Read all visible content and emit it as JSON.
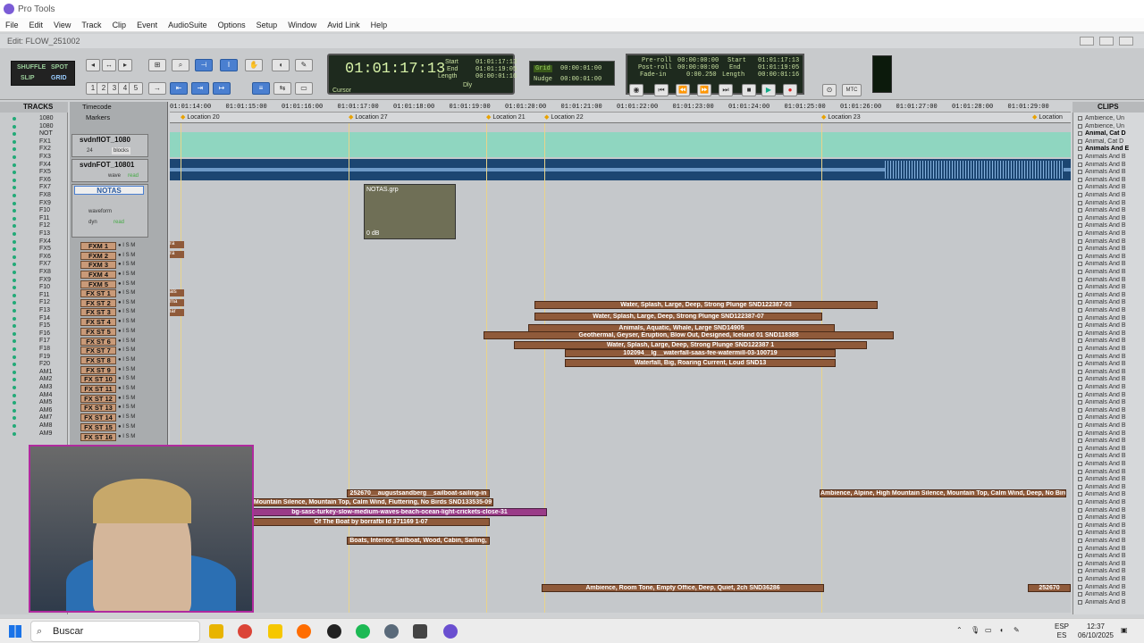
{
  "window": {
    "app_title": "Pro Tools",
    "edit_title": "Edit: FLOW_251002"
  },
  "menu": [
    "File",
    "Edit",
    "View",
    "Track",
    "Clip",
    "Event",
    "AudioSuite",
    "Options",
    "Setup",
    "Window",
    "Avid Link",
    "Help"
  ],
  "toolbar": {
    "modes": [
      "SHUFFLE",
      "SPOT",
      "SLIP",
      "GRID"
    ],
    "zoom_presets": [
      "1",
      "2",
      "3",
      "4",
      "5"
    ]
  },
  "counter": {
    "main": "01:01:17:13",
    "start_label": "Start",
    "end_label": "End",
    "length_label": "Length",
    "start": "01:01:17:13",
    "end": "01:01:19:05",
    "length": "00:00:01:16",
    "cursor_label": "Cursor",
    "dly": "Dly"
  },
  "grid": {
    "grid_label": "Grid",
    "grid_value": "00:00:01:00",
    "nudge_label": "Nudge",
    "nudge_value": "00:00:01:00"
  },
  "transport": {
    "preroll_label": "Pre-roll",
    "postroll_label": "Post-roll",
    "fadein_label": "Fade-in",
    "preroll": "00:00:00:00",
    "postroll": "00:00:00:00",
    "fadein": "0:00.250",
    "start_label": "Start",
    "end_label": "End",
    "length_label": "Length",
    "start": "01:01:17:13",
    "end": "01:01:19:05",
    "length": "00:00:01:16",
    "mtc": "MTC"
  },
  "tracks_panel": {
    "header": "TRACKS",
    "items": [
      "1080",
      "1080",
      "NOT",
      "FX1",
      "FX2",
      "FX3",
      "FX4",
      "FX5",
      "FX6",
      "FX7",
      "FX8",
      "FX9",
      "F10",
      "F11",
      "F12",
      "F13",
      "FX4",
      "FX5",
      "FX6",
      "FX7",
      "FX8",
      "FX9",
      "F10",
      "F11",
      "F12",
      "F13",
      "F14",
      "F15",
      "F16",
      "F17",
      "F18",
      "F19",
      "F20",
      "AM1",
      "AM2",
      "AM3",
      "AM4",
      "AM5",
      "AM6",
      "AM7",
      "AM8",
      "AM9"
    ]
  },
  "rulers": {
    "timecode_label": "Timecode",
    "markers_label": "Markers",
    "ticks": [
      "01:01:14:00",
      "01:01:15:00",
      "01:01:16:00",
      "01:01:17:00",
      "01:01:18:00",
      "01:01:19:00",
      "01:01:20:00",
      "01:01:21:00",
      "01:01:22:00",
      "01:01:23:00",
      "01:01:24:00",
      "01:01:25:00",
      "01:01:26:00",
      "01:01:27:00",
      "01:01:28:00",
      "01:01:29:00"
    ],
    "markers": [
      "Location 20",
      "Location 27",
      "Location 21",
      "Location 22",
      "Location 23",
      "Location"
    ]
  },
  "track_headers": {
    "video1": "svdnfIOT_1080",
    "video1_sub": "24",
    "video1_view": "blocks",
    "video2": "svdnFOT_10801",
    "video2_view": "wave",
    "video2_sub": "read",
    "notas": "NOTAS",
    "notas_view": "waveform",
    "notas_dyn": "dyn",
    "notas_read": "read",
    "fxm": [
      "FXM 1",
      "FXM 2",
      "FXM 3",
      "FXM 4",
      "FXM 5"
    ],
    "fxst": [
      "FX ST 1",
      "FX ST 2",
      "FX ST 3",
      "FX ST 4",
      "FX ST 5",
      "FX ST 6",
      "FX ST 7",
      "FX ST 8",
      "FX ST 9",
      "FX ST 10",
      "FX ST 11",
      "FX ST 12",
      "FX ST 13",
      "FX ST 14",
      "FX ST 15",
      "FX ST 16"
    ]
  },
  "group_clip": {
    "name": "NOTAS.grp",
    "gain": "0 dB"
  },
  "clips": {
    "fx": [
      "Water, Splash, Large, Deep, Strong Plunge SND122387-03",
      "Water, Splash, Large, Deep, Strong Plunge SND122387-07",
      "Animals, Aquatic, Whale, Large SND14905",
      "Geothermal, Geyser, Eruption, Blow Out, Designed, Iceland 01 SND118385",
      "Water, Splash, Large, Deep, Strong Plunge SND122387 1",
      "102094__lg__waterfall-saas-fee-watermill-03-100719",
      "Waterfall, Big, Roaring Current, Loud SND13"
    ],
    "amb": [
      "252670__augustsandberg__sailboat-sailing-in",
      "Mountain Silence, Mountain Top, Calm Wind, Fluttering, No Birds SND133535-09",
      "bg-sasc-turkey-slow-medium-waves-beach-ocean-light-crickets-close-31",
      "Of The Boat by borrafbi Id 371169 1-07",
      "Boats, Interior, Sailboat, Wood, Cabin, Sailing,",
      "Ambience, Alpine, High Mountain Silence, Mountain Top, Calm Wind, Deep, No Bird",
      "Ambience, Room Tone, Empty Office, Deep, Quiet, 2ch SND36286",
      "252670"
    ],
    "left_stubs": [
      "ra",
      "ra",
      "als",
      "ma",
      "iar"
    ]
  },
  "clips_panel": {
    "header": "CLIPS",
    "items": [
      "Ambience, Un",
      "Ambience, Un",
      "Animal, Cat D",
      "Animal, Cat D",
      "Animals And E",
      "Animals And B",
      "Animals And B",
      "Animals And B",
      "Animals And B",
      "Animals And B",
      "Animals And B",
      "Animals And B",
      "Animals And B",
      "Animals And B",
      "Animals And B",
      "Animals And B",
      "Animals And B",
      "Animals And B",
      "Animals And B",
      "Animals And B",
      "Animals And B",
      "Animals And B",
      "Animals And B",
      "Animals And B",
      "Animals And B",
      "Animals And B",
      "Animals And B",
      "Animals And B",
      "Animals And B",
      "Animals And B",
      "Animals And B",
      "Animals And B",
      "Animals And B",
      "Animals And B",
      "Animals And B",
      "Animals And B",
      "Animals And B",
      "Animals And B",
      "Animals And B",
      "Animals And B",
      "Animals And B",
      "Animals And B",
      "Animals And B",
      "Animals And B",
      "Animals And B",
      "Animals And B",
      "Animals And B",
      "Animals And B",
      "Animals And B",
      "Animals And B",
      "Animals And B",
      "Animals And B",
      "Animals And B",
      "Animals And B",
      "Animals And B",
      "Animals And B",
      "Animals And B",
      "Animals And B",
      "Animals And B",
      "Animals And B",
      "Animals And B",
      "Animals And B",
      "Animals And B",
      "Animals And B",
      "Animals And B",
      "Animals And B"
    ]
  },
  "taskbar": {
    "search_placeholder": "Buscar",
    "lang_top": "ESP",
    "lang_bottom": "ES",
    "time": "12:37",
    "date": "06/10/2025"
  },
  "colors": {
    "accent": "#4a7fd0",
    "clip_brown": "#8f5a3a",
    "clip_pink": "#9a3b88",
    "video_teal": "#8fd6c0",
    "waveform_blue": "#1c4672"
  }
}
